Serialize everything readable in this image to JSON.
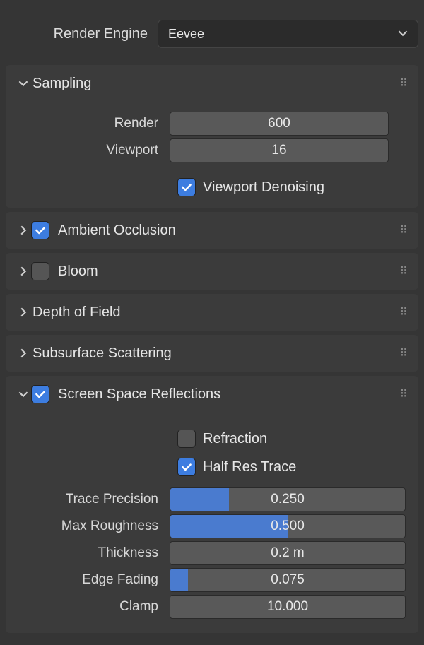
{
  "render_engine": {
    "label": "Render Engine",
    "value": "Eevee"
  },
  "sampling": {
    "title": "Sampling",
    "render_label": "Render",
    "render_value": "600",
    "viewport_label": "Viewport",
    "viewport_value": "16",
    "viewport_denoise_label": "Viewport Denoising"
  },
  "ambient_occlusion": {
    "title": "Ambient Occlusion"
  },
  "bloom": {
    "title": "Bloom"
  },
  "dof": {
    "title": "Depth of Field"
  },
  "sss": {
    "title": "Subsurface Scattering"
  },
  "ssr": {
    "title": "Screen Space Reflections",
    "refraction_label": "Refraction",
    "half_res_label": "Half Res Trace",
    "trace_precision_label": "Trace Precision",
    "trace_precision_value": "0.250",
    "max_roughness_label": "Max Roughness",
    "max_roughness_value": "0.500",
    "thickness_label": "Thickness",
    "thickness_value": "0.2 m",
    "edge_fading_label": "Edge Fading",
    "edge_fading_value": "0.075",
    "clamp_label": "Clamp",
    "clamp_value": "10.000"
  }
}
